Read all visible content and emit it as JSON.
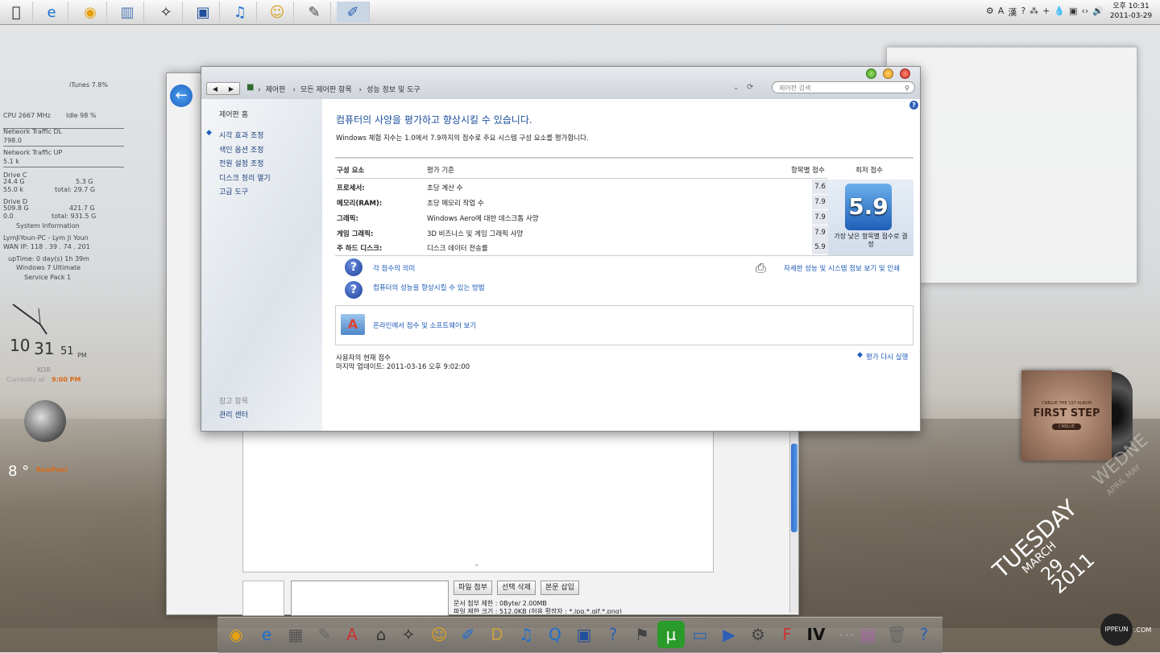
{
  "topbar": {
    "icons": [
      "apple-icon",
      "internet-explorer-icon",
      "chrome-icon",
      "library-icon",
      "zbrush-icon",
      "kmplayer-icon",
      "itunes-icon",
      "messenger-icon",
      "photoshop-icon",
      "notes-icon"
    ],
    "tray": [
      "⚙",
      "A",
      "漢",
      "?",
      "⁂",
      "+",
      "💧",
      "▣",
      "‹›",
      "🔊"
    ],
    "clock_time": "오후 10:31",
    "clock_date": "2011-03-29"
  },
  "gadget": {
    "itunes": "iTunes 7.8%",
    "cpu": "CPU 2667 MHz",
    "idle": "Idle 98 %",
    "net_dl_label": "Network Traffic DL",
    "net_dl_value": "798.0",
    "net_up_label": "Network Traffic UP",
    "net_up_value": "5.1 k",
    "drive_c_label": "Drive C",
    "drive_c_used": "24.4 G",
    "drive_c_free": "5.3 G",
    "drive_c_pct": "55.0 k",
    "drive_c_total": "total: 29.7 G",
    "drive_d_label": "Drive D",
    "drive_d_used": "509.8 G",
    "drive_d_free": "421.7 G",
    "drive_d_pct": "0.0",
    "drive_d_total": "total: 931.5 G",
    "sysinfo": "System Information",
    "user": "LymJiYoun-PC - Lym Ji Youn",
    "wan": "WAN IP: 118 . 39 . 74 . 201",
    "uptime": "upTime: 0 day(s) 1h 39m",
    "os": "Windows 7 Ultimate",
    "sp": "Service Pack 1",
    "clock_h": "10",
    "clock_m": "31",
    "clock_s": "51",
    "clock_ampm": "PM",
    "kor": "KOR",
    "currently": "Currently at",
    "current_time": "9:00 PM",
    "temp": "8 °",
    "realfeel": "RealFeel"
  },
  "main": {
    "breadcrumbs": [
      "제어판",
      "모든 제어판 항목",
      "성능 정보 및 도구"
    ],
    "search_placeholder": "제어판 검색",
    "sidebar": {
      "home": "제어판 홈",
      "items": [
        "시각 효과 조정",
        "색인 옵션 조정",
        "전원 설정 조정",
        "디스크 정리 열기",
        "고급 도구"
      ],
      "see_also": "참고 항목",
      "action_center": "관리 센터"
    },
    "title": "컴퓨터의 사양을 평가하고 향상시킬 수 있습니다.",
    "subtitle": "Windows 체험 지수는 1.0에서 7.9까지의 점수로 주요 시스템 구성 요소를 평가합니다.",
    "headers": {
      "component": "구성 요소",
      "criteria": "평가 기준",
      "subscore": "항목별 점수",
      "base": "최저 점수"
    },
    "rows": [
      {
        "component": "프로세서:",
        "criteria": "초당 계산 수",
        "score": "7.6"
      },
      {
        "component": "메모리(RAM):",
        "criteria": "초당 메모리 작업 수",
        "score": "7.9"
      },
      {
        "component": "그래픽:",
        "criteria": "Windows Aero에 대한 데스크톱 사양",
        "score": "7.9"
      },
      {
        "component": "게임 그래픽:",
        "criteria": "3D 비즈니스 및 게임 그래픽 사양",
        "score": "7.9"
      },
      {
        "component": "주 하드 디스크:",
        "criteria": "디스크 데이터 전송률",
        "score": "5.9"
      }
    ],
    "base_score": "5.9",
    "base_caption": "가장 낮은 항목별 점수로 결정",
    "link_meaning": "각 점수의 의미",
    "link_improve": "컴퓨터의 성능을 향상시킬 수 있는 방법",
    "link_detail": "자세한 성능 및 시스템 정보 보기 및 인쇄",
    "link_online": "온라인에서 점수 및 소프트웨어 보기",
    "current_score_label": "사용자의 현재 점수",
    "last_update": "마지막 업데이트: 2011-03-16 오후 9:02:00",
    "rerun": "평가 다시 실행"
  },
  "back_window": {
    "btn_attach": "파일 첨부",
    "btn_delete": "선택 삭제",
    "btn_insert": "본문 삽입",
    "limit_text": "문서 첨부 제한 : 0Byte/ 2.00MB",
    "ext_text": "파일 제한 크기 : 512.0KB (허용 확장자 : *.jpg,*.gif,*.png)"
  },
  "album": {
    "subtitle": "CNBLUE THE 1ST ALBUM",
    "title": "FIRST STEP",
    "brand": "CNBLUE"
  },
  "date_widget": {
    "day": "TUESDAY",
    "month": "MARCH",
    "date": "29",
    "year": "2011",
    "next_day": "WEDNE",
    "next_month": "APRIL MAY"
  },
  "watermark": {
    "logo": "IPPEUN",
    "suffix": ".COM"
  }
}
